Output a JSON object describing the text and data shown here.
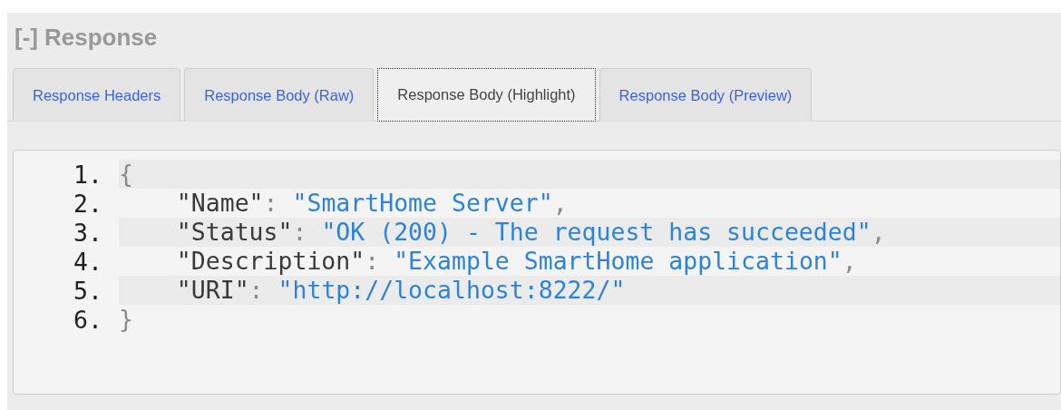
{
  "section": {
    "toggle": "[-]",
    "title": "Response"
  },
  "tabs": [
    {
      "label": "Response Headers",
      "selected": false
    },
    {
      "label": "Response Body (Raw)",
      "selected": false
    },
    {
      "label": "Response Body (Highlight)",
      "selected": true
    },
    {
      "label": "Response Body (Preview)",
      "selected": false
    }
  ],
  "code": {
    "lines": [
      {
        "number": "1.",
        "tokens": [
          {
            "kind": "punct",
            "text": "{"
          }
        ],
        "children": [
          {
            "number": "2.",
            "tokens": [
              {
                "kind": "key",
                "text": "\"Name\""
              },
              {
                "kind": "punct",
                "text": ": "
              },
              {
                "kind": "string",
                "text": "\"SmartHome Server\""
              },
              {
                "kind": "punct",
                "text": ","
              }
            ]
          },
          {
            "number": "3.",
            "tokens": [
              {
                "kind": "key",
                "text": "\"Status\""
              },
              {
                "kind": "punct",
                "text": ": "
              },
              {
                "kind": "string",
                "text": "\"OK (200) - The request has succeeded\""
              },
              {
                "kind": "punct",
                "text": ","
              }
            ]
          },
          {
            "number": "4.",
            "tokens": [
              {
                "kind": "key",
                "text": "\"Description\""
              },
              {
                "kind": "punct",
                "text": ": "
              },
              {
                "kind": "string",
                "text": "\"Example SmartHome application\""
              },
              {
                "kind": "punct",
                "text": ","
              }
            ]
          },
          {
            "number": "5.",
            "tokens": [
              {
                "kind": "key",
                "text": "\"URI\""
              },
              {
                "kind": "punct",
                "text": ": "
              },
              {
                "kind": "string",
                "text": "\"http://localhost:8222/\""
              }
            ]
          }
        ]
      },
      {
        "number": "6.",
        "tokens": [
          {
            "kind": "punct",
            "text": "}"
          }
        ]
      }
    ]
  }
}
